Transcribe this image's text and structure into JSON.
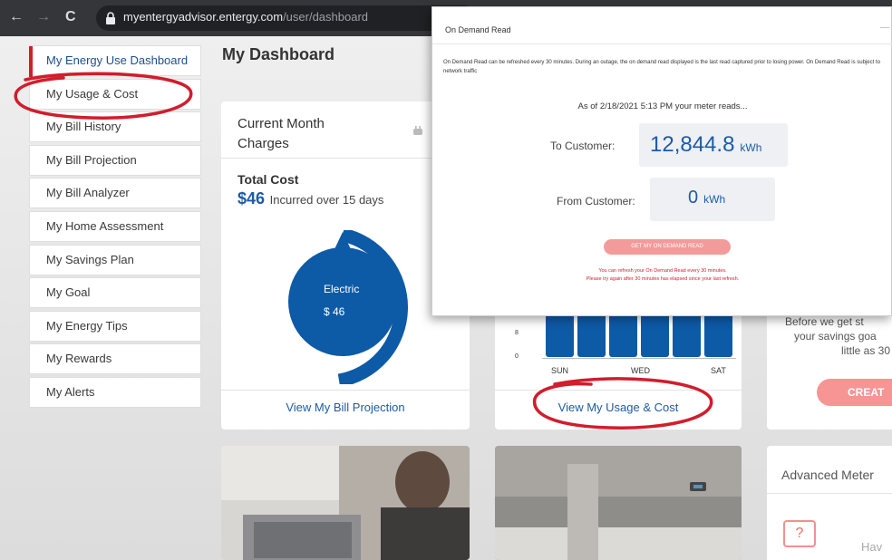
{
  "browser": {
    "back": "←",
    "forward": "→",
    "reload": "C",
    "url_host": "myentergyadvisor.entergy.com",
    "url_path": "/user/dashboard"
  },
  "sidebar": {
    "items": [
      {
        "label": "My Energy Use Dashboard",
        "active": true
      },
      {
        "label": "My Usage & Cost"
      },
      {
        "label": "My Bill History"
      },
      {
        "label": "My Bill Projection"
      },
      {
        "label": "My Bill Analyzer"
      },
      {
        "label": "My Home Assessment"
      },
      {
        "label": "My Savings Plan"
      },
      {
        "label": "My Goal"
      },
      {
        "label": "My Energy Tips"
      },
      {
        "label": "My Rewards"
      },
      {
        "label": "My Alerts"
      }
    ]
  },
  "dashboard": {
    "title": "My Dashboard",
    "charges_card": {
      "title": "Current Month Charges",
      "total_label": "Total Cost",
      "amount": "$46",
      "incurred_text": "Incurred over 15 days",
      "donut_label": "Electric",
      "donut_value": "$ 46",
      "link": "View My Bill Projection"
    },
    "usage_card": {
      "y_ticks": [
        "8",
        "0"
      ],
      "days": [
        "SUN",
        "WED",
        "SAT"
      ],
      "link": "View My Usage & Cost"
    },
    "savings_card": {
      "text_line1": "Before we get st",
      "text_line2": "your savings goa",
      "text_line3": "little as 30",
      "button": "CREAT"
    },
    "meter_card": {
      "title": "Advanced Meter",
      "icon_glyph": "?",
      "partial_text": "Hav"
    }
  },
  "modal": {
    "title": "On Demand Read",
    "description": "On Demand Read can be refreshed every 30 minutes. During an outage, the on demand read displayed is the last read captured prior to losing power. On Demand Read is subject to network traffic",
    "as_of": "As of 2/18/2021 5:13 PM your meter reads...",
    "to_label": "To Customer:",
    "to_value": "12,844.8",
    "to_unit": "kWh",
    "from_label": "From Customer:",
    "from_value": "0",
    "from_unit": "kWh",
    "button": "GET MY ON DEMAND READ",
    "note_line1": "You can refresh your On Demand Read every 30 minutes.",
    "note_line2": "Please try again after 30 minutes has elapsed since your last refresh."
  },
  "colors": {
    "brand_blue": "#1c5ba7",
    "donut_blue": "#0d5aa7",
    "accent_red": "#d11d2c",
    "button_pink": "#f39a9a"
  }
}
